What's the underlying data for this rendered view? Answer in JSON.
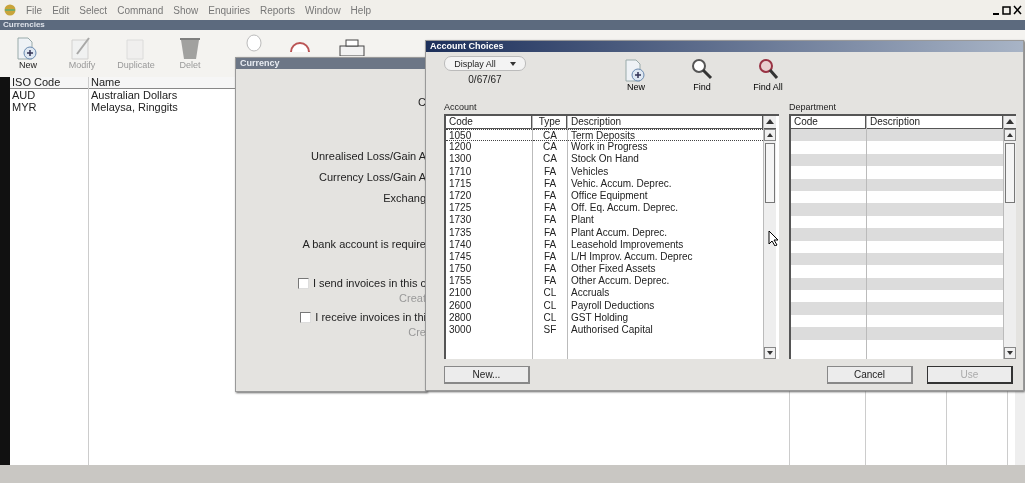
{
  "menu_bar": [
    "File",
    "Edit",
    "Select",
    "Command",
    "Show",
    "Enquiries",
    "Reports",
    "Window",
    "Help"
  ],
  "window": {
    "title": "Currencies"
  },
  "toolbar": [
    {
      "label": "New",
      "disabled": false,
      "kind": "new"
    },
    {
      "label": "Modify",
      "disabled": true,
      "kind": "modify"
    },
    {
      "label": "Duplicate",
      "disabled": true,
      "kind": "duplicate"
    },
    {
      "label": "Delet",
      "disabled": true,
      "kind": "delete"
    }
  ],
  "currency_list": {
    "columns": [
      "ISO Code",
      "Name"
    ],
    "rows": [
      [
        "AUD",
        "Australian Dollars"
      ],
      [
        "MYR",
        "Melaysa, Ringgits"
      ]
    ]
  },
  "currency_dialog": {
    "title": "Currency",
    "lines": [
      {
        "kind": "label",
        "text": "C"
      },
      {
        "kind": "label",
        "text": "Unrealised Loss/Gain A"
      },
      {
        "kind": "label",
        "text": "Currency Loss/Gain A"
      },
      {
        "kind": "label",
        "text": "Exchang"
      },
      {
        "kind": "label",
        "text": "A bank account is require"
      },
      {
        "kind": "checkbox",
        "text": "I send invoices in this c",
        "checked": false
      },
      {
        "kind": "hint",
        "text": "Creat"
      },
      {
        "kind": "checkbox",
        "text": "I receive invoices in thi",
        "checked": false
      },
      {
        "kind": "hint",
        "text": "Cre"
      }
    ]
  },
  "account_choices": {
    "title": "Account Choices",
    "filter": "Display All",
    "count": "0/67/67",
    "toolbar": [
      {
        "label": "New",
        "kind": "new"
      },
      {
        "label": "Find",
        "kind": "find"
      },
      {
        "label": "Find All",
        "kind": "findall"
      }
    ],
    "account_label": "Account",
    "account_columns": [
      "Code",
      "Type",
      "Description"
    ],
    "accounts": [
      {
        "code": "1050",
        "type": "CA",
        "description": "Term Deposits",
        "selected": true
      },
      {
        "code": "1200",
        "type": "CA",
        "description": "Work in Progress",
        "selected": false
      },
      {
        "code": "1300",
        "type": "CA",
        "description": "Stock On Hand",
        "selected": false
      },
      {
        "code": "1710",
        "type": "FA",
        "description": "Vehicles",
        "selected": false
      },
      {
        "code": "1715",
        "type": "FA",
        "description": "Vehic. Accum. Deprec.",
        "selected": false
      },
      {
        "code": "1720",
        "type": "FA",
        "description": "Office Equipment",
        "selected": false
      },
      {
        "code": "1725",
        "type": "FA",
        "description": "Off. Eq. Accum. Deprec.",
        "selected": false
      },
      {
        "code": "1730",
        "type": "FA",
        "description": "Plant",
        "selected": false
      },
      {
        "code": "1735",
        "type": "FA",
        "description": "Plant Accum. Deprec.",
        "selected": false
      },
      {
        "code": "1740",
        "type": "FA",
        "description": "Leasehold Improvements",
        "selected": false
      },
      {
        "code": "1745",
        "type": "FA",
        "description": "L/H Improv. Accum. Deprec",
        "selected": false
      },
      {
        "code": "1750",
        "type": "FA",
        "description": "Other Fixed Assets",
        "selected": false
      },
      {
        "code": "1755",
        "type": "FA",
        "description": "Other Accum. Deprec.",
        "selected": false
      },
      {
        "code": "2100",
        "type": "CL",
        "description": "Accruals",
        "selected": false
      },
      {
        "code": "2600",
        "type": "CL",
        "description": "Payroll Deductions",
        "selected": false
      },
      {
        "code": "2800",
        "type": "CL",
        "description": "GST Holding",
        "selected": false
      },
      {
        "code": "3000",
        "type": "SF",
        "description": "Authorised Capital",
        "selected": false
      }
    ],
    "department_label": "Department",
    "department_columns": [
      "Code",
      "Description"
    ],
    "buttons": [
      {
        "label": "New...",
        "disabled": false
      },
      {
        "label": "Cancel",
        "disabled": false
      },
      {
        "label": "Use",
        "disabled": true
      }
    ]
  }
}
